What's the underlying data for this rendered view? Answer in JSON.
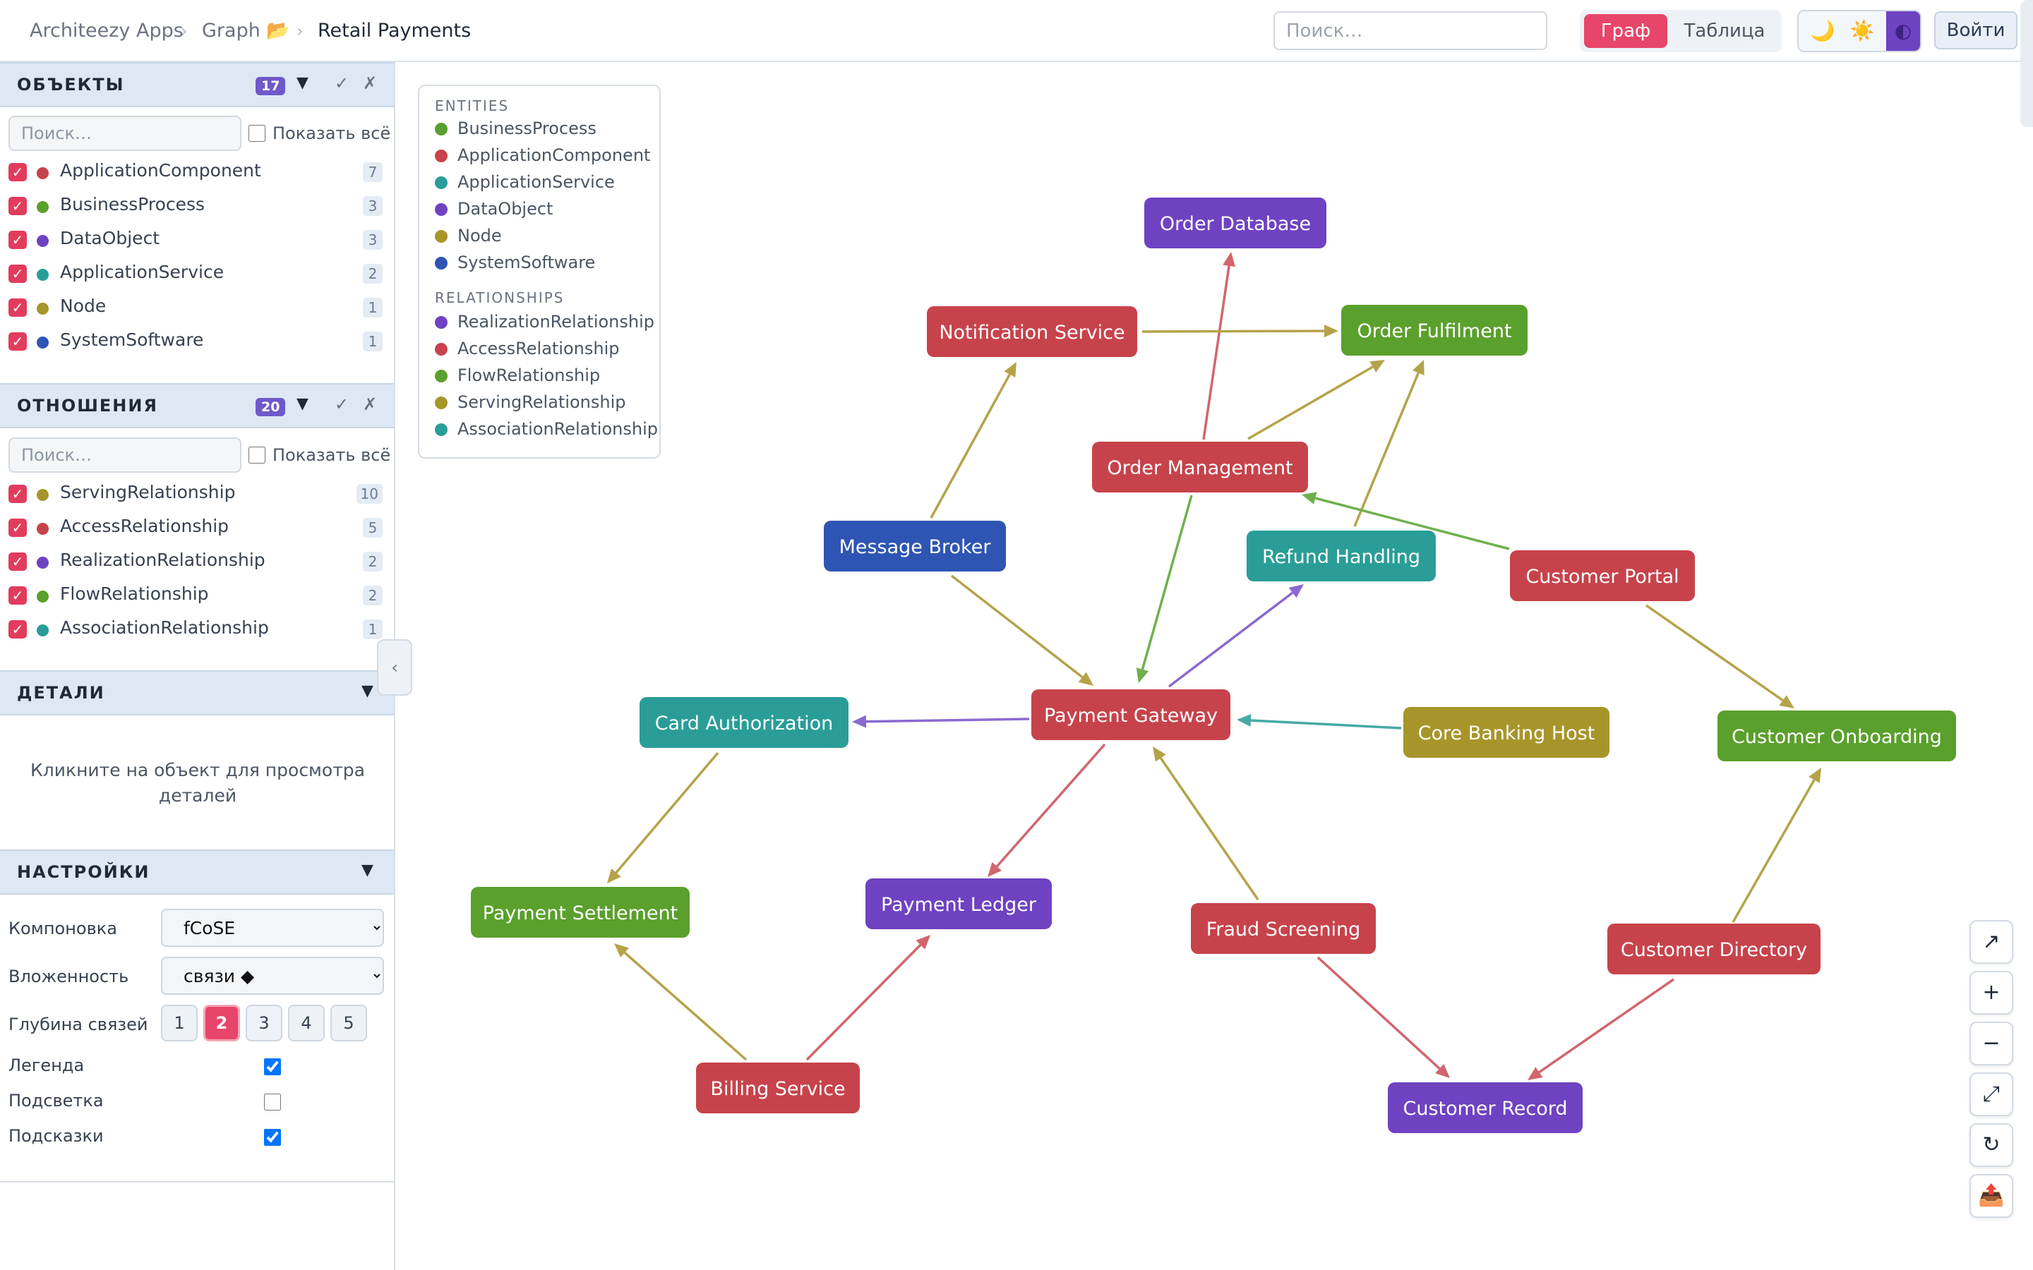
{
  "breadcrumb": {
    "app": "Architeezy Apps",
    "graph": "Graph 📂",
    "current": "Retail Payments",
    "sep": "›"
  },
  "top_search": {
    "placeholder": "Поиск…"
  },
  "view_toggle": {
    "graph": "Граф",
    "table": "Таблица"
  },
  "theme": {
    "dark_icon": "🌙",
    "light_icon": "☀️",
    "contrast_icon": "◐"
  },
  "login": "Войти",
  "objects": {
    "title": "ОБЪЕКТЫ",
    "count": "17",
    "caret": "▼",
    "check_all": "✓",
    "clear_all": "✗",
    "search_placeholder": "Поиск…",
    "show_all": "Показать всё",
    "items": [
      {
        "label": "ApplicationComponent",
        "count": "7",
        "color": "#c7434b"
      },
      {
        "label": "BusinessProcess",
        "count": "3",
        "color": "#5aa02c"
      },
      {
        "label": "DataObject",
        "count": "3",
        "color": "#6f42c1"
      },
      {
        "label": "ApplicationService",
        "count": "2",
        "color": "#2a9d98"
      },
      {
        "label": "Node",
        "count": "1",
        "color": "#a8952a"
      },
      {
        "label": "SystemSoftware",
        "count": "1",
        "color": "#2e55b3"
      }
    ]
  },
  "relations": {
    "title": "ОТНОШЕНИЯ",
    "count": "20",
    "caret": "▼",
    "check_all": "✓",
    "clear_all": "✗",
    "search_placeholder": "Поиск…",
    "show_all": "Показать всё",
    "items": [
      {
        "label": "ServingRelationship",
        "count": "10",
        "color": "#a8952a"
      },
      {
        "label": "AccessRelationship",
        "count": "5",
        "color": "#c7434b"
      },
      {
        "label": "RealizationRelationship",
        "count": "2",
        "color": "#6f42c1"
      },
      {
        "label": "FlowRelationship",
        "count": "2",
        "color": "#5aa02c"
      },
      {
        "label": "AssociationRelationship",
        "count": "1",
        "color": "#2a9d98"
      }
    ]
  },
  "details": {
    "title": "ДЕТАЛИ",
    "caret": "▼",
    "hint": "Кликните на объект для просмотра деталей"
  },
  "settings": {
    "title": "НАСТРОЙКИ",
    "caret": "▼",
    "layout_label": "Компоновка",
    "layout_value": "fCoSE",
    "nesting_label": "Вложенность",
    "nesting_value": "связи ◆",
    "depth_label": "Глубина связей",
    "depth_options": [
      "1",
      "2",
      "3",
      "4",
      "5"
    ],
    "depth_selected": "2",
    "legend_label": "Легенда",
    "legend_checked": true,
    "highlight_label": "Подсветка",
    "highlight_checked": false,
    "tooltips_label": "Подсказки",
    "tooltips_checked": true
  },
  "collapse_icon": "‹",
  "legend": {
    "entities_title": "ENTITIES",
    "entities": [
      {
        "label": "BusinessProcess",
        "color": "#5aa02c"
      },
      {
        "label": "ApplicationComponent",
        "color": "#c7434b"
      },
      {
        "label": "ApplicationService",
        "color": "#2a9d98"
      },
      {
        "label": "DataObject",
        "color": "#6f42c1"
      },
      {
        "label": "Node",
        "color": "#a8952a"
      },
      {
        "label": "SystemSoftware",
        "color": "#2e55b3"
      }
    ],
    "relationships_title": "RELATIONSHIPS",
    "relationships": [
      {
        "label": "RealizationRelationship",
        "color": "#6f42c1"
      },
      {
        "label": "AccessRelationship",
        "color": "#c7434b"
      },
      {
        "label": "FlowRelationship",
        "color": "#5aa02c"
      },
      {
        "label": "ServingRelationship",
        "color": "#a8952a"
      },
      {
        "label": "AssociationRelationship",
        "color": "#2a9d98"
      }
    ]
  },
  "graph": {
    "nodes": [
      {
        "id": "order-database",
        "label": "Order Database",
        "type": "DataObject",
        "color": "#6f42c1"
      },
      {
        "id": "notification-service",
        "label": "Notification Service",
        "type": "ApplicationComponent",
        "color": "#c7434b"
      },
      {
        "id": "order-fulfilment",
        "label": "Order Fulfilment",
        "type": "BusinessProcess",
        "color": "#5aa02c"
      },
      {
        "id": "order-management",
        "label": "Order Management",
        "type": "ApplicationComponent",
        "color": "#c7434b"
      },
      {
        "id": "message-broker",
        "label": "Message Broker",
        "type": "SystemSoftware",
        "color": "#2e55b3"
      },
      {
        "id": "refund-handling",
        "label": "Refund Handling",
        "type": "ApplicationService",
        "color": "#2a9d98"
      },
      {
        "id": "customer-portal",
        "label": "Customer Portal",
        "type": "ApplicationComponent",
        "color": "#c7434b"
      },
      {
        "id": "card-authorization",
        "label": "Card Authorization",
        "type": "ApplicationService",
        "color": "#2a9d98"
      },
      {
        "id": "payment-gateway",
        "label": "Payment Gateway",
        "type": "ApplicationComponent",
        "color": "#c7434b"
      },
      {
        "id": "core-banking-host",
        "label": "Core Banking Host",
        "type": "Node",
        "color": "#a8952a"
      },
      {
        "id": "customer-onboarding",
        "label": "Customer Onboarding",
        "type": "BusinessProcess",
        "color": "#5aa02c"
      },
      {
        "id": "payment-settlement",
        "label": "Payment Settlement",
        "type": "BusinessProcess",
        "color": "#5aa02c"
      },
      {
        "id": "payment-ledger",
        "label": "Payment Ledger",
        "type": "DataObject",
        "color": "#6f42c1"
      },
      {
        "id": "fraud-screening",
        "label": "Fraud Screening",
        "type": "ApplicationComponent",
        "color": "#c7434b"
      },
      {
        "id": "customer-directory",
        "label": "Customer Directory",
        "type": "ApplicationComponent",
        "color": "#c7434b"
      },
      {
        "id": "billing-service",
        "label": "Billing Service",
        "type": "ApplicationComponent",
        "color": "#c7434b"
      },
      {
        "id": "customer-record",
        "label": "Customer Record",
        "type": "DataObject",
        "color": "#6f42c1"
      }
    ],
    "edges": [
      {
        "from": "order-management",
        "to": "order-database",
        "type": "AccessRelationship",
        "color": "#d2656d"
      },
      {
        "from": "notification-service",
        "to": "order-fulfilment",
        "type": "ServingRelationship",
        "color": "#b5a34a"
      },
      {
        "from": "order-management",
        "to": "order-fulfilment",
        "type": "ServingRelationship",
        "color": "#b5a34a"
      },
      {
        "from": "refund-handling",
        "to": "order-fulfilment",
        "type": "ServingRelationship",
        "color": "#b5a34a"
      },
      {
        "from": "message-broker",
        "to": "notification-service",
        "type": "ServingRelationship",
        "color": "#b5a34a"
      },
      {
        "from": "customer-portal",
        "to": "order-management",
        "type": "FlowRelationship",
        "color": "#6fb04d"
      },
      {
        "from": "order-management",
        "to": "payment-gateway",
        "type": "FlowRelationship",
        "color": "#6fb04d"
      },
      {
        "from": "message-broker",
        "to": "payment-gateway",
        "type": "ServingRelationship",
        "color": "#b5a34a"
      },
      {
        "from": "payment-gateway",
        "to": "refund-handling",
        "type": "RealizationRelationship",
        "color": "#8a6ad0"
      },
      {
        "from": "payment-gateway",
        "to": "card-authorization",
        "type": "RealizationRelationship",
        "color": "#8a6ad0"
      },
      {
        "from": "core-banking-host",
        "to": "payment-gateway",
        "type": "AssociationRelationship",
        "color": "#45aaa5"
      },
      {
        "from": "customer-portal",
        "to": "customer-onboarding",
        "type": "ServingRelationship",
        "color": "#b5a34a"
      },
      {
        "from": "card-authorization",
        "to": "payment-settlement",
        "type": "ServingRelationship",
        "color": "#b5a34a"
      },
      {
        "from": "payment-gateway",
        "to": "payment-ledger",
        "type": "AccessRelationship",
        "color": "#d2656d"
      },
      {
        "from": "fraud-screening",
        "to": "payment-gateway",
        "type": "ServingRelationship",
        "color": "#b5a34a"
      },
      {
        "from": "billing-service",
        "to": "payment-settlement",
        "type": "ServingRelationship",
        "color": "#b5a34a"
      },
      {
        "from": "billing-service",
        "to": "payment-ledger",
        "type": "AccessRelationship",
        "color": "#d2656d"
      },
      {
        "from": "customer-directory",
        "to": "customer-onboarding",
        "type": "ServingRelationship",
        "color": "#b5a34a"
      },
      {
        "from": "fraud-screening",
        "to": "customer-record",
        "type": "AccessRelationship",
        "color": "#d2656d"
      },
      {
        "from": "customer-directory",
        "to": "customer-record",
        "type": "AccessRelationship",
        "color": "#d2656d"
      }
    ]
  },
  "zoom_controls": {
    "external": "↗",
    "zoom_in": "+",
    "zoom_out": "−",
    "fit": "⤢",
    "reset": "↻",
    "export": "📤"
  }
}
